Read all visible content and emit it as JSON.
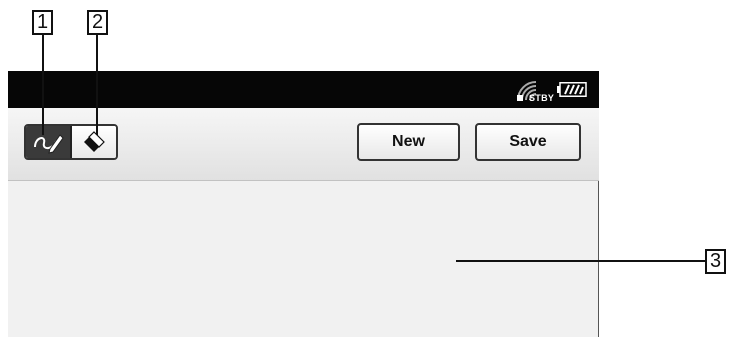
{
  "callouts": {
    "one": "1",
    "two": "2",
    "three": "3"
  },
  "status_bar": {
    "standby_label": "STBY",
    "wifi_icon": "wifi-signal-icon",
    "battery_icon": "battery-icon"
  },
  "toolbar": {
    "pen_tool_icon": "pen-tool-icon",
    "eraser_tool_icon": "eraser-tool-icon",
    "new_label": "New",
    "save_label": "Save"
  },
  "colors": {
    "status_bar_bg": "#060606",
    "toolbar_bg": "#e8e8e8",
    "canvas_bg": "#f1f1f1",
    "selected_tool_bg": "#3a3a3a"
  }
}
